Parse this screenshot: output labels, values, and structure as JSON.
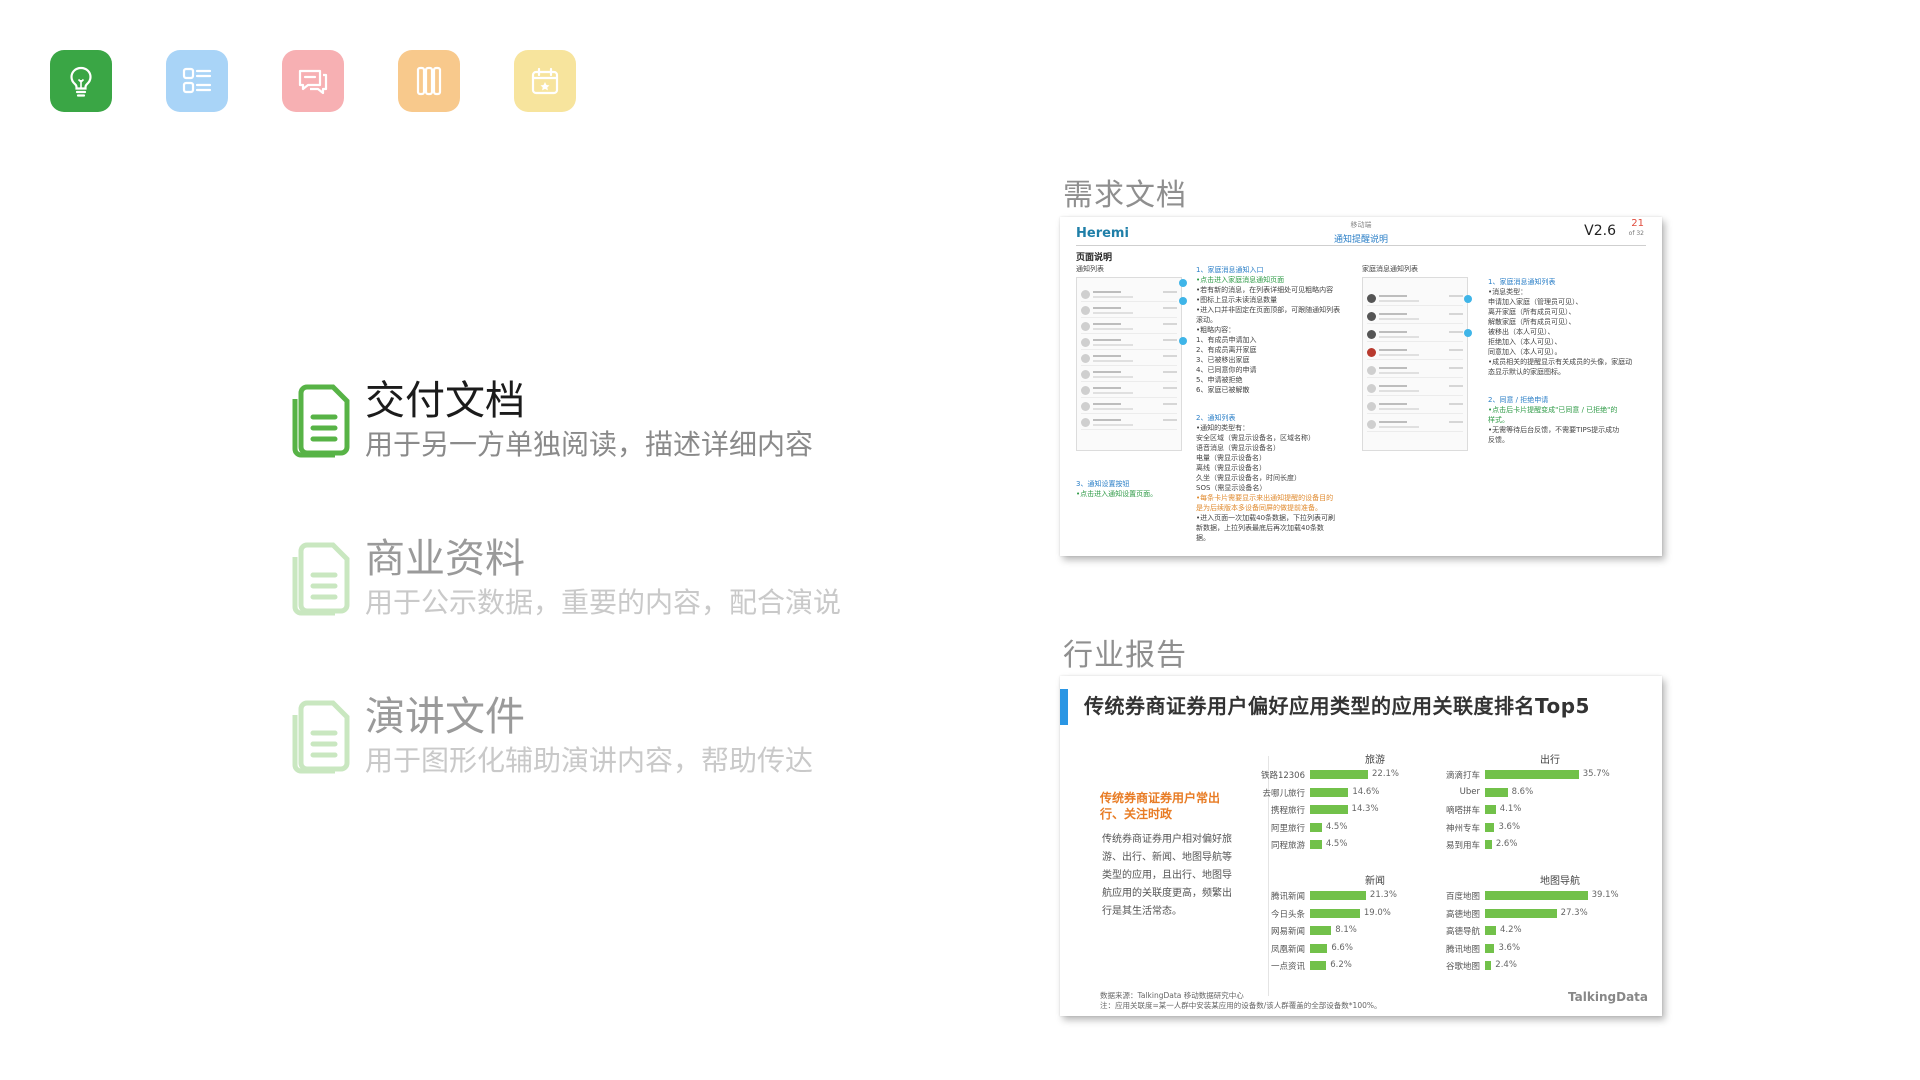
{
  "app_icons": [
    {
      "name": "lightbulb-icon",
      "color": "#3aa645"
    },
    {
      "name": "list-icon",
      "color": "#a9d4f7"
    },
    {
      "name": "chat-icon",
      "color": "#f7b0b3"
    },
    {
      "name": "columns-icon",
      "color": "#f8c98c"
    },
    {
      "name": "calendar-icon",
      "color": "#f7e49d"
    }
  ],
  "doc_list": [
    {
      "title": "交付文档",
      "desc": "用于另一方单独阅读，描述详细内容"
    },
    {
      "title": "商业资料",
      "desc": "用于公示数据，重要的内容，配合演说"
    },
    {
      "title": "演讲文件",
      "desc": "用于图形化辅助演讲内容，帮助传达"
    }
  ],
  "sections": {
    "requirement": "需求文档",
    "industry": "行业报告"
  },
  "req_slide": {
    "brand": "Heremi",
    "sub": "移动端",
    "subtitle": "通知提醒说明",
    "version": "V2.6",
    "page": "21",
    "page_of": "of 32",
    "heading": "页面说明",
    "left_label": "通知列表",
    "right_label": "家庭消息通知列表",
    "col1": "1、家庭消息通知入口",
    "col1_green": "•点击进入家庭消息通知页面",
    "col1_body": "•若有新的消息，在列表详细处可见粗略内容\n•图标上显示未读消息数量\n•进入口并非固定在页面顶部，可跟随通知列表\n滚动。\n•粗略内容：\n1、有成员申请加入\n2、有成员离开家庭\n3、已被移出家庭\n4、已同意你的申请\n5、申请被拒绝\n6、家庭已被解散",
    "col1_2": "2、通知列表",
    "col1_2_body": "•通知的类型有：\n安全区域（需显示设备名，区域名称）\n语音消息（需显示设备名）\n电量（需显示设备名）\n离线（需显示设备名）\n久坐（需显示设备名，时间长度）\nSOS（需显示设备名）",
    "col1_2_orange": "•每条卡片需要显示来出通知提醒的设备目的\n是为后续版本多设备同屏的做提前准备。",
    "col1_2_tail": "•进入页面一次加载40条数据，下拉列表可刷\n新数据，上拉列表最底后再次加载40条数\n据。",
    "col3": "3、通知设置按钮",
    "col3_green": "•点击进入通知设置页面。",
    "col2": "1、家庭消息通知列表",
    "col2_body": "•消息类型：\n申请加入家庭（管理员可见）、\n离开家庭（所有成员可见）、\n解散家庭（所有成员可见）、\n被移出（本人可见）、\n拒绝加入（本人可见）、\n同意加入（本人可见）。\n•成员相关的提醒显示有关成员的头像，家庭动\n态显示默认的家庭图标。",
    "col2_2": "2、同意 / 拒绝申请",
    "col2_2_green": "•点击后卡片提醒变成\"已同意 / 已拒绝\"的\n样式。",
    "col2_2_body": "•无需等待后台反馈，不需要TIPS提示成功\n反馈。"
  },
  "ind_slide": {
    "title": "传统券商证券用户偏好应用类型的应用关联度排名Top5",
    "highlight": "传统券商证券用户常出\n行、关注时政",
    "body": "传统券商证券用户相对偏好旅\n游、出行、新闻、地图导航等\n类型的应用，且出行、地图导\n航应用的关联度更高，频繁出\n行是其生活常态。",
    "note1": "数据来源：TalkingData 移动数据研究中心",
    "note2": "注：应用关联度=某一人群中安装某应用的设备数/该人群覆盖的全部设备数*100%。",
    "logo": "TalkingData"
  },
  "chart_data": [
    {
      "type": "bar",
      "title": "旅游",
      "categories": [
        "铁路12306",
        "去哪儿旅行",
        "携程旅行",
        "阿里旅行",
        "同程旅游"
      ],
      "values": [
        22.1,
        14.6,
        14.3,
        4.5,
        4.5
      ],
      "labels": [
        "22.1%",
        "14.6%",
        "14.3%",
        "4.5%",
        "4.5%"
      ]
    },
    {
      "type": "bar",
      "title": "出行",
      "categories": [
        "滴滴打车",
        "Uber",
        "嘀嗒拼车",
        "神州专车",
        "易到用车"
      ],
      "values": [
        35.7,
        8.6,
        4.1,
        3.6,
        2.6
      ],
      "labels": [
        "35.7%",
        "8.6%",
        "4.1%",
        "3.6%",
        "2.6%"
      ]
    },
    {
      "type": "bar",
      "title": "新闻",
      "categories": [
        "腾讯新闻",
        "今日头条",
        "网易新闻",
        "凤凰新闻",
        "一点资讯"
      ],
      "values": [
        21.3,
        19.0,
        8.1,
        6.6,
        6.2
      ],
      "labels": [
        "21.3%",
        "19.0%",
        "8.1%",
        "6.6%",
        "6.2%"
      ]
    },
    {
      "type": "bar",
      "title": "地图导航",
      "categories": [
        "百度地图",
        "高德地图",
        "高德导航",
        "腾讯地图",
        "谷歌地图"
      ],
      "values": [
        39.1,
        27.3,
        4.2,
        3.6,
        2.4
      ],
      "labels": [
        "39.1%",
        "27.3%",
        "4.2%",
        "3.6%",
        "2.4%"
      ]
    }
  ]
}
